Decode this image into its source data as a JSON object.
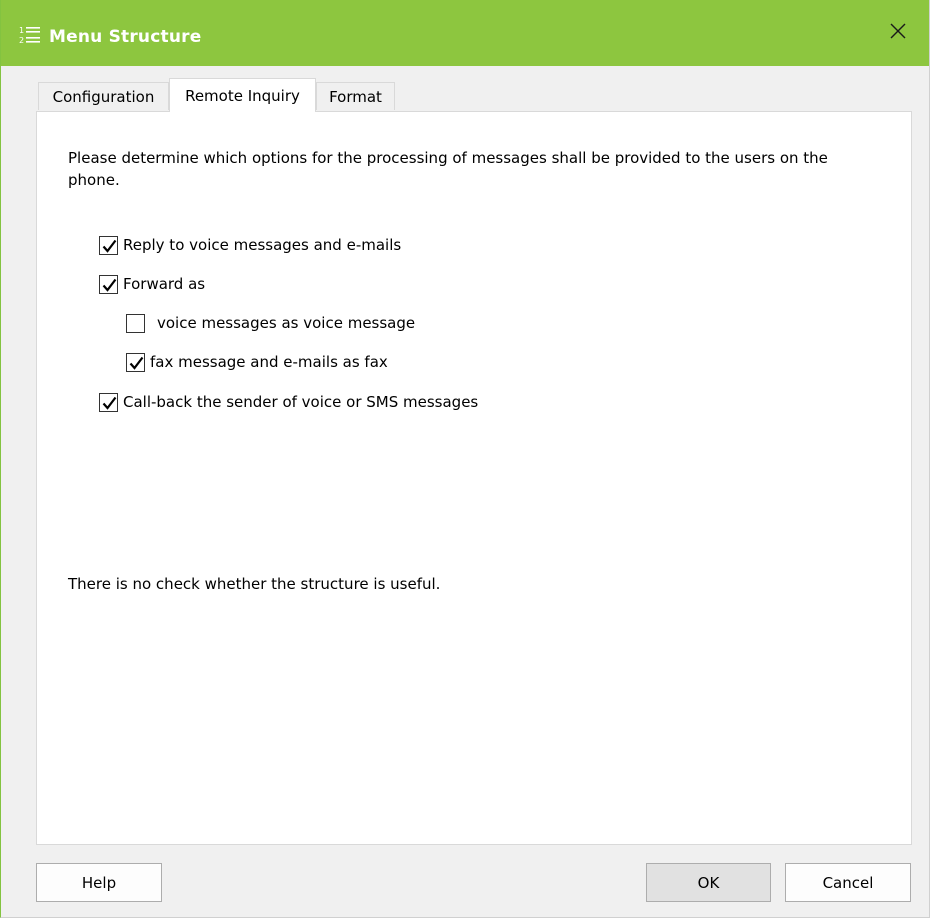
{
  "window": {
    "title": "Menu Structure",
    "title_icon": "numbered-list-icon",
    "close_icon": "close-icon",
    "accent_color": "#8dc63f"
  },
  "tabs": [
    {
      "label": "Configuration",
      "active": false
    },
    {
      "label": "Remote Inquiry",
      "active": true
    },
    {
      "label": "Format",
      "active": false
    }
  ],
  "content": {
    "intro": "Please determine which options for the processing of messages shall be provided to the users on the phone.",
    "options": [
      {
        "label": "Reply to voice messages and e-mails",
        "checked": true
      },
      {
        "label": "Forward as",
        "checked": true
      },
      {
        "label": "voice messages as voice message",
        "checked": false
      },
      {
        "label": "fax message and e-mails as fax",
        "checked": true
      },
      {
        "label": "Call-back the sender of voice or SMS messages",
        "checked": true
      }
    ],
    "note": "There is no check whether the structure is useful."
  },
  "buttons": {
    "help": "Help",
    "ok": "OK",
    "cancel": "Cancel"
  }
}
